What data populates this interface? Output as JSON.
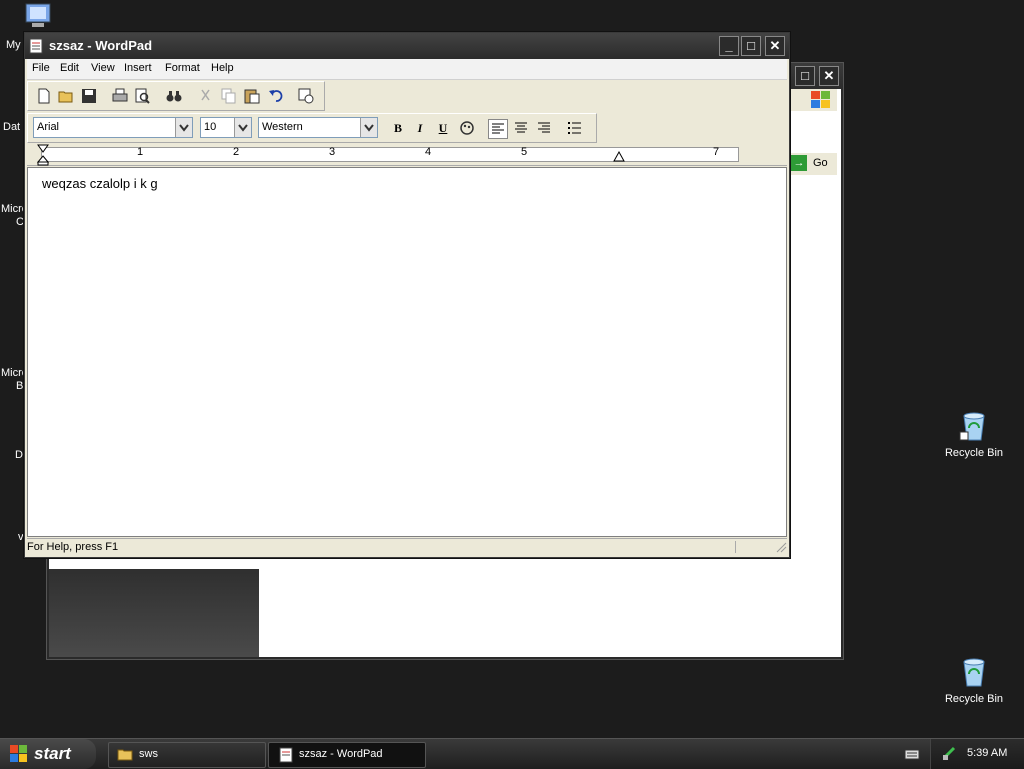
{
  "desktop": {
    "left_labels": [
      "My",
      "Dat",
      "Micro",
      "C",
      "Micro",
      "B",
      "D",
      "v"
    ],
    "recycle_bin_1": "Recycle Bin",
    "recycle_bin_2": "Recycle Bin"
  },
  "background_window": {
    "go_label": "Go"
  },
  "wordpad": {
    "title": "szsaz - WordPad",
    "menu": [
      "File",
      "Edit",
      "View",
      "Insert",
      "Format",
      "Help"
    ],
    "toolbar_icons": [
      "new-document-icon",
      "open-folder-icon",
      "save-icon",
      "print-icon",
      "print-preview-icon",
      "find-icon",
      "cut-icon",
      "copy-icon",
      "paste-icon",
      "undo-icon",
      "date-time-icon"
    ],
    "font_name": "Arial",
    "font_size": "10",
    "script": "Western",
    "bold_label": "B",
    "italic_label": "I",
    "underline_label": "U",
    "ruler_numbers": [
      "1",
      "2",
      "3",
      "4",
      "5",
      "7"
    ],
    "document_text": "weqzas czalolp i k g",
    "status_text": "For Help, press F1"
  },
  "taskbar": {
    "start_label": "start",
    "tasks": [
      {
        "label": "sws",
        "icon": "folder-icon"
      },
      {
        "label": "szsaz - WordPad",
        "icon": "wordpad-icon"
      }
    ],
    "clock": "5:39 AM"
  },
  "colors": {
    "desktop_bg": "#1c1c1c",
    "go_green": "#2e9b36"
  }
}
